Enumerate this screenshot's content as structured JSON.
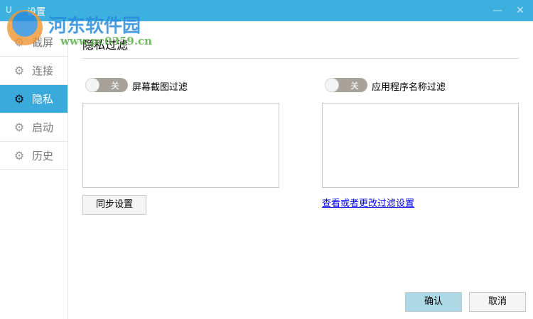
{
  "window": {
    "logo": "U",
    "title": "设置",
    "minimize_icon": "minimize-icon",
    "close_icon": "close-icon"
  },
  "sidebar": {
    "items": [
      {
        "label": "截屏",
        "icon": "gear-icon"
      },
      {
        "label": "连接",
        "icon": "gear-icon"
      },
      {
        "label": "隐私",
        "icon": "gear-icon",
        "active": true
      },
      {
        "label": "启动",
        "icon": "gear-icon"
      },
      {
        "label": "历史",
        "icon": "gear-icon"
      }
    ]
  },
  "main": {
    "header": "隐私过滤",
    "screen_filter": {
      "toggle_state": "关",
      "label": "屏幕截图过滤",
      "sync_button": "同步设置"
    },
    "app_filter": {
      "toggle_state": "关",
      "label": "应用程序名称过滤",
      "link": "查看或者更改过滤设置"
    },
    "ok_button": "确认",
    "cancel_button": "取消"
  },
  "watermark": {
    "name": "河东软件园",
    "url": "www.pc0359.cn"
  },
  "colors": {
    "titlebar": "#3eb0e0",
    "active_nav": "#3aa9db",
    "ok_button": "#add8e6",
    "toggle_off": "#a8a39a"
  }
}
